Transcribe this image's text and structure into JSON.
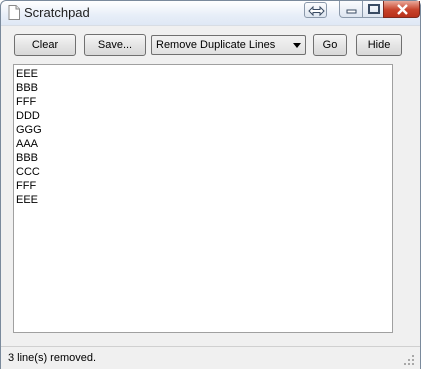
{
  "window": {
    "title": "Scratchpad"
  },
  "toolbar": {
    "clear_label": "Clear",
    "save_label": "Save...",
    "operation_selected": "Remove Duplicate Lines",
    "go_label": "Go",
    "hide_label": "Hide"
  },
  "editor": {
    "lines": [
      "EEE",
      "BBB",
      "FFF",
      "DDD",
      "GGG",
      "AAA",
      "BBB",
      "CCC",
      "FFF",
      "EEE"
    ]
  },
  "status": {
    "text": "3 line(s) removed."
  }
}
